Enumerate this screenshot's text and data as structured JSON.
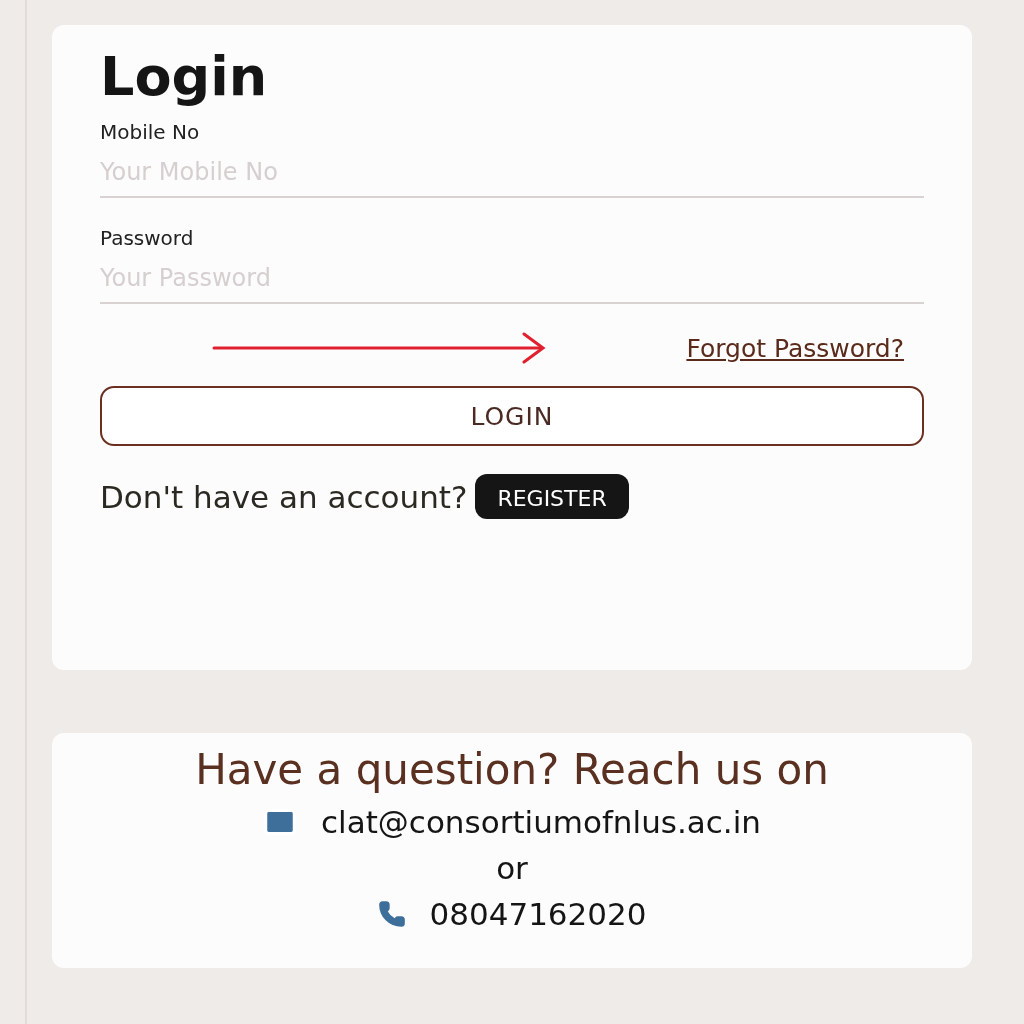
{
  "login": {
    "title": "Login",
    "fields": [
      {
        "label": "Mobile No",
        "placeholder": "Your Mobile No"
      },
      {
        "label": "Password",
        "placeholder": "Your Password"
      }
    ],
    "forgot_link": "Forgot Password?",
    "login_button": "LOGIN",
    "register_prompt": "Don't have an account?",
    "register_button": "REGISTER"
  },
  "contact": {
    "heading": "Have a question? Reach us on",
    "email": "clat@consortiumofnlus.ac.in",
    "separator": "or",
    "phone": "08047162020"
  }
}
